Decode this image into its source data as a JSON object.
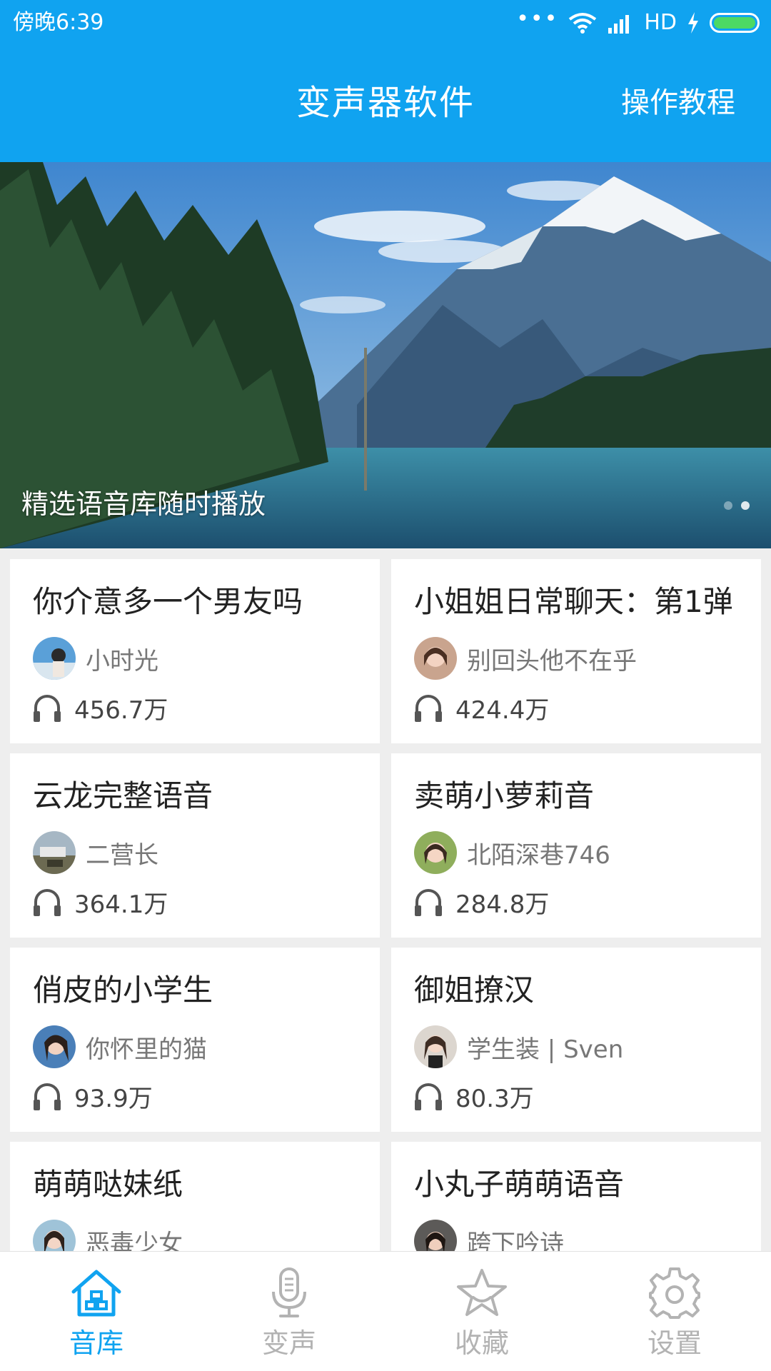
{
  "status_bar": {
    "time": "傍晚6:39",
    "dots": "•••",
    "network": "HD"
  },
  "header": {
    "title": "变声器软件",
    "tutorial": "操作教程"
  },
  "banner": {
    "caption": "精选语音库随时播放"
  },
  "cards": [
    {
      "title": "你介意多一个男友吗",
      "author": "小时光",
      "plays": "456.7万"
    },
    {
      "title": "小姐姐日常聊天：第1弹",
      "author": "别回头他不在乎",
      "plays": "424.4万"
    },
    {
      "title": "云龙完整语音",
      "author": "二营长",
      "plays": "364.1万"
    },
    {
      "title": "卖萌小萝莉音",
      "author": "北陌深巷746",
      "plays": "284.8万"
    },
    {
      "title": "俏皮的小学生",
      "author": "你怀里的猫",
      "plays": "93.9万"
    },
    {
      "title": "御姐撩汉",
      "author": "学生装 | Sven",
      "plays": "80.3万"
    },
    {
      "title": "萌萌哒妹纸",
      "author": "恶毒少女",
      "plays": ""
    },
    {
      "title": "小丸子萌萌语音",
      "author": "跨下吟诗",
      "plays": ""
    }
  ],
  "bottom_nav": [
    {
      "label": "音库",
      "icon": "house-icon",
      "active": true
    },
    {
      "label": "变声",
      "icon": "microphone-icon",
      "active": false
    },
    {
      "label": "收藏",
      "icon": "star-icon",
      "active": false
    },
    {
      "label": "设置",
      "icon": "gear-icon",
      "active": false
    }
  ],
  "colors": {
    "primary": "#10a3f0",
    "inactive": "#b3b3b3",
    "background": "#eeeeee"
  }
}
